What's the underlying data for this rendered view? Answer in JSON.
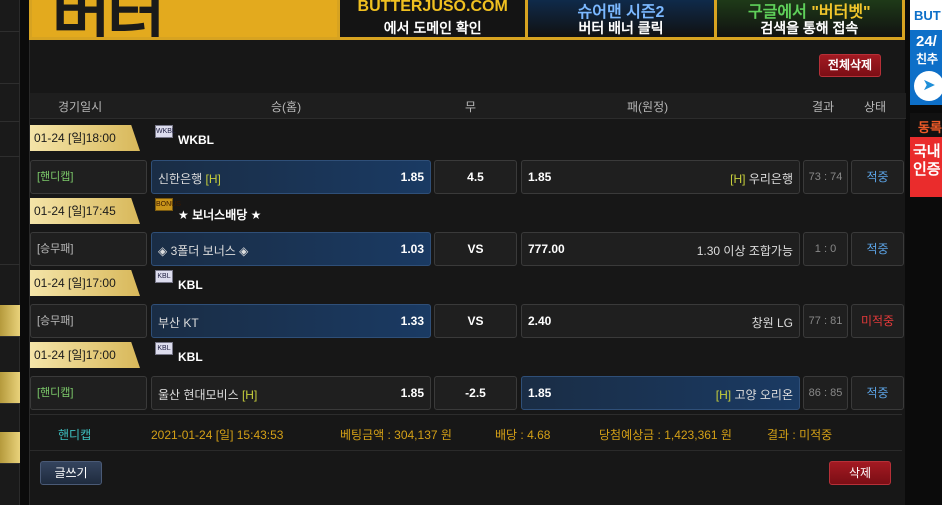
{
  "banner": {
    "cells": [
      {
        "l1": "BUTTERJUSO.COM",
        "l2": "에서 도메인 확인"
      },
      {
        "l1": "슈어맨 시즌2",
        "l2": "버터 배너 클릭"
      },
      {
        "l1_pre": "구글에서 ",
        "l1_hl": "\"버터벳\"",
        "l2": "검색을 통해 접속"
      }
    ]
  },
  "right_ads": {
    "ad1_top": "BUT",
    "ad1_line2": "24/",
    "ad1_line3": "친추",
    "ad2_title": "동록",
    "ad2_line1": "국내",
    "ad2_line2": "인증"
  },
  "toolbar": {
    "delete_all": "전체삭제"
  },
  "table_header": {
    "date": "경기일시",
    "home": "승(홈)",
    "draw": "무",
    "away": "패(원정)",
    "result": "결과",
    "status": "상태"
  },
  "games": [
    {
      "date": "01-24 [일]18:00",
      "league_icon": "WKBL",
      "league": "WKBL",
      "bet_type": "[핸디캡]",
      "home_name": "신한은행",
      "home_mark": "[H]",
      "home_odd": "1.85",
      "draw": "4.5",
      "away_odd": "1.85",
      "away_mark": "[H]",
      "away_name": "우리은행",
      "score": "73 : 74",
      "status": "적중"
    },
    {
      "date": "01-24 [일]17:45",
      "league_icon": "BONUS",
      "league": "★ 보너스배당 ★",
      "bet_type": "[승무패]",
      "home_name": "◈ 3폴더 보너스 ◈",
      "home_mark": "",
      "home_odd": "1.03",
      "draw": "VS",
      "away_odd": "777.00",
      "away_mark": "",
      "away_name": "1.30 이상 조합가능",
      "score": "1 : 0",
      "status": "적중"
    },
    {
      "date": "01-24 [일]17:00",
      "league_icon": "KBL",
      "league": "KBL",
      "bet_type": "[승무패]",
      "home_name": "부산 KT",
      "home_mark": "",
      "home_odd": "1.33",
      "draw": "VS",
      "away_odd": "2.40",
      "away_mark": "",
      "away_name": "창원 LG",
      "score": "77 : 81",
      "status": "미적중"
    },
    {
      "date": "01-24 [일]17:00",
      "league_icon": "KBL",
      "league": "KBL",
      "bet_type": "[핸디캡]",
      "home_name": "울산 현대모비스",
      "home_mark": "[H]",
      "home_odd": "1.85",
      "draw": "-2.5",
      "away_odd": "1.85",
      "away_mark": "[H]",
      "away_name": "고양 오리온",
      "score": "86 : 85",
      "status": "적중"
    }
  ],
  "summary": {
    "kind": "핸디캡",
    "datetime": "2021-01-24 [일] 15:43:53",
    "bet_amount": "베팅금액 : 304,137 원",
    "odds": "배당 : 4.68",
    "expected": "당첨예상금 : 1,423,361 원",
    "result": "결과 : 미적중"
  },
  "actions": {
    "write": "글쓰기",
    "delete": "삭제"
  }
}
